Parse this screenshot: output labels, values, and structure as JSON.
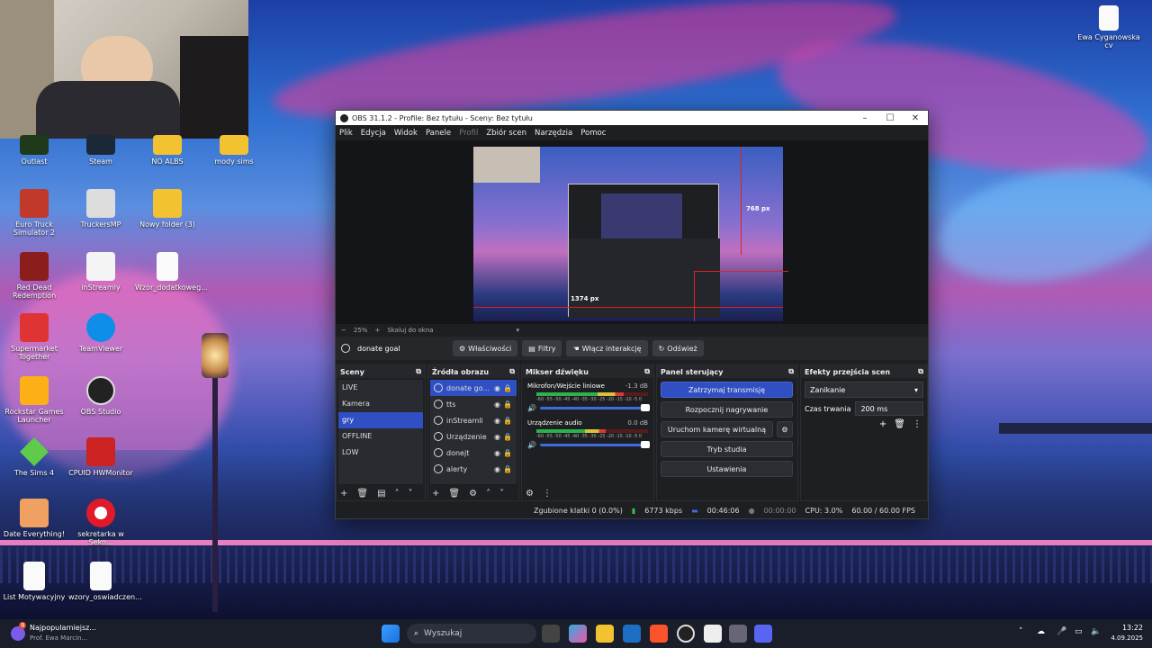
{
  "desktop_icons": [
    {
      "name": "outlast",
      "label": "Outlast",
      "x": 0
    },
    {
      "name": "steam",
      "label": "Steam"
    },
    {
      "name": "no-albs",
      "label": "NO ALBS"
    },
    {
      "name": "mody-sims",
      "label": "mody sims"
    },
    {
      "name": "euro-truck",
      "label": "Euro Truck Simulator 2"
    },
    {
      "name": "truckersmp",
      "label": "TruckersMP"
    },
    {
      "name": "nowy-folder",
      "label": "Nowy folder (3)"
    },
    {
      "name": "red-dead",
      "label": "Red Dead Redemption"
    },
    {
      "name": "instreamly",
      "label": "inStreamly"
    },
    {
      "name": "wzor",
      "label": "Wzor_dodatkoweg..."
    },
    {
      "name": "supermarket",
      "label": "Supermarket Together"
    },
    {
      "name": "teamviewer",
      "label": "TeamViewer"
    },
    {
      "name": "rockstar",
      "label": "Rockstar Games Launcher"
    },
    {
      "name": "obs-studio",
      "label": "OBS Studio"
    },
    {
      "name": "sims4",
      "label": "The Sims 4"
    },
    {
      "name": "cpuid",
      "label": "CPUID HWMonitor"
    },
    {
      "name": "date-everything",
      "label": "Date Everything!"
    },
    {
      "name": "sekretarka",
      "label": "sekretarka w Seko..."
    },
    {
      "name": "list-motywacyjny",
      "label": "List Motywacyjny"
    },
    {
      "name": "wzory-oswiadczen",
      "label": "wzory_oswiadczen..."
    },
    {
      "name": "cv",
      "label": "Ewa Cyganowska cv"
    }
  ],
  "obs": {
    "title": "OBS 31.1.2 - Profile: Bez tytułu - Sceny: Bez tytułu",
    "menu": [
      "Plik",
      "Edycja",
      "Widok",
      "Panele",
      "Profil",
      "Zbiór scen",
      "Narzędzia",
      "Pomoc"
    ],
    "preview": {
      "zoom": "25%",
      "fit": "Skaluj do okna",
      "dim1": "768 px",
      "dim2": "1374 px"
    },
    "source_bar": {
      "selected": "donate goal",
      "props": "Właściwości",
      "filters": "Filtry",
      "interact": "Włącz interakcję",
      "refresh": "Odśwież"
    },
    "scenes": {
      "title": "Sceny",
      "items": [
        "LIVE",
        "Kamera",
        "gry",
        "OFFLINE",
        "LOW"
      ],
      "selected": 2
    },
    "sources": {
      "title": "Źródła obrazu",
      "items": [
        "donate go...",
        "tts",
        "inStreamli",
        "Urządzenie",
        "donejt",
        "alerty"
      ]
    },
    "mixer": {
      "title": "Mikser dźwięku",
      "channels": [
        {
          "name": "Mikrofon/Wejście liniowe",
          "db": "-1.3 dB",
          "scale": "-60 -55 -50 -45 -40 -35 -30 -25 -20 -15 -10 -5 0",
          "level": 0.78
        },
        {
          "name": "Urządzenie audio",
          "db": "0.0 dB",
          "scale": "-60 -55 -50 -45 -40 -35 -30 -25 -20 -15 -10 -5 0",
          "level": 0.62
        }
      ]
    },
    "controls": {
      "title": "Panel sterujący",
      "stop_stream": "Zatrzymaj transmisję",
      "start_record": "Rozpocznij nagrywanie",
      "virtual_cam": "Uruchom kamerę wirtualną",
      "studio": "Tryb studia",
      "settings": "Ustawienia"
    },
    "transitions": {
      "title": "Efekty przejścia scen",
      "type": "Zanikanie",
      "duration_label": "Czas trwania",
      "duration": "200 ms"
    },
    "status": {
      "dropped": "Zgubione klatki 0 (0.0%)",
      "bitrate": "6773 kbps",
      "live_time": "00:46:06",
      "rec_time": "00:00:00",
      "cpu": "CPU: 3.0%",
      "fps": "60.00 / 60.00 FPS"
    }
  },
  "taskbar": {
    "notif_count": "8",
    "notif_title": "Najpopularniejsz...",
    "notif_sub": "Prof. Ewa Marcin...",
    "search_placeholder": "Wyszukaj",
    "time": "13:22",
    "date": "4.09.2025"
  },
  "colors": {
    "accent": "#2f4fc2",
    "record_red": "#e02020"
  }
}
